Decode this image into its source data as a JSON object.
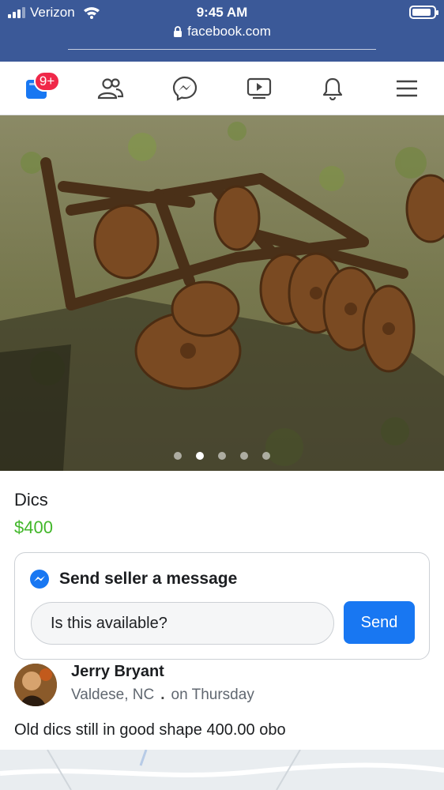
{
  "status_bar": {
    "carrier": "Verizon",
    "time": "9:45 AM",
    "url": "facebook.com",
    "battery_level": 0.9
  },
  "nav": {
    "items": [
      {
        "icon": "marketplace-icon",
        "badge": "9+"
      },
      {
        "icon": "friends-icon"
      },
      {
        "icon": "messenger-icon"
      },
      {
        "icon": "watch-icon"
      },
      {
        "icon": "notifications-bell-icon"
      },
      {
        "icon": "menu-icon"
      }
    ]
  },
  "photo": {
    "subject": "disc-harrow-photo",
    "carousel_count": 5,
    "active_index": 1
  },
  "listing": {
    "title": "Dics",
    "price": "$400",
    "price_color": "#42b72a"
  },
  "message": {
    "title": "Send seller a message",
    "input_value": "Is this available?",
    "send_label": "Send",
    "accent": "#1877f2"
  },
  "seller": {
    "name": "Jerry Bryant",
    "location": "Valdese, NC",
    "separator": ".",
    "posted": "on Thursday"
  },
  "description": "Old dics still in good shape 400.00 obo",
  "colors": {
    "header_blue": "#3b5998",
    "badge_red": "#f02849"
  }
}
